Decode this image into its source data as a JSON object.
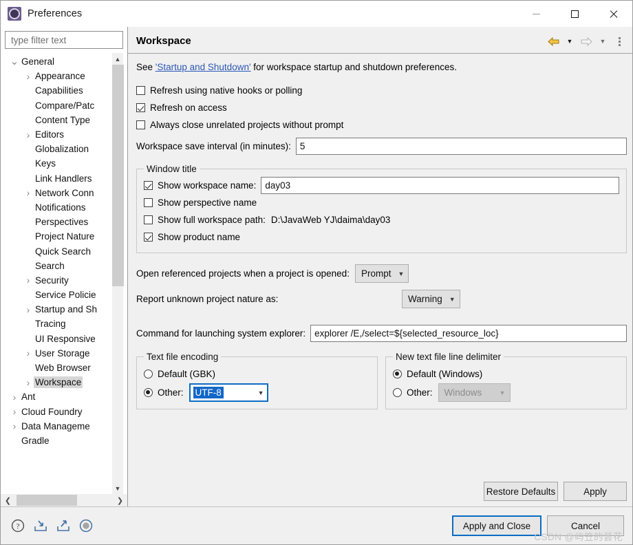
{
  "window": {
    "title": "Preferences",
    "icon": "preferences-gear-icon",
    "controls": {
      "minimize": "—",
      "maximize": "□",
      "close": "✕"
    }
  },
  "sidebar": {
    "filter": {
      "value": "",
      "placeholder": "type filter text"
    },
    "items": [
      {
        "label": "General",
        "level": 0,
        "twisty": "down",
        "selected": false
      },
      {
        "label": "Appearance",
        "level": 1,
        "twisty": "right",
        "selected": false
      },
      {
        "label": "Capabilities",
        "level": 1,
        "twisty": "none",
        "selected": false
      },
      {
        "label": "Compare/Patc",
        "level": 1,
        "twisty": "none",
        "selected": false
      },
      {
        "label": "Content Type",
        "level": 1,
        "twisty": "none",
        "selected": false
      },
      {
        "label": "Editors",
        "level": 1,
        "twisty": "right",
        "selected": false
      },
      {
        "label": "Globalization",
        "level": 1,
        "twisty": "none",
        "selected": false
      },
      {
        "label": "Keys",
        "level": 1,
        "twisty": "none",
        "selected": false
      },
      {
        "label": "Link Handlers",
        "level": 1,
        "twisty": "none",
        "selected": false
      },
      {
        "label": "Network Conn",
        "level": 1,
        "twisty": "right",
        "selected": false
      },
      {
        "label": "Notifications",
        "level": 1,
        "twisty": "none",
        "selected": false
      },
      {
        "label": "Perspectives",
        "level": 1,
        "twisty": "none",
        "selected": false
      },
      {
        "label": "Project Nature",
        "level": 1,
        "twisty": "none",
        "selected": false
      },
      {
        "label": "Quick Search",
        "level": 1,
        "twisty": "none",
        "selected": false
      },
      {
        "label": "Search",
        "level": 1,
        "twisty": "none",
        "selected": false
      },
      {
        "label": "Security",
        "level": 1,
        "twisty": "right",
        "selected": false
      },
      {
        "label": "Service Policie",
        "level": 1,
        "twisty": "none",
        "selected": false
      },
      {
        "label": "Startup and Sh",
        "level": 1,
        "twisty": "right",
        "selected": false
      },
      {
        "label": "Tracing",
        "level": 1,
        "twisty": "none",
        "selected": false
      },
      {
        "label": "UI Responsive",
        "level": 1,
        "twisty": "none",
        "selected": false
      },
      {
        "label": "User Storage",
        "level": 1,
        "twisty": "right",
        "selected": false
      },
      {
        "label": "Web Browser",
        "level": 1,
        "twisty": "none",
        "selected": false
      },
      {
        "label": "Workspace",
        "level": 1,
        "twisty": "right",
        "selected": true
      },
      {
        "label": "Ant",
        "level": 0,
        "twisty": "right",
        "selected": false
      },
      {
        "label": "Cloud Foundry",
        "level": 0,
        "twisty": "right",
        "selected": false
      },
      {
        "label": "Data Manageme",
        "level": 0,
        "twisty": "right",
        "selected": false
      },
      {
        "label": "Gradle",
        "level": 0,
        "twisty": "none",
        "selected": false
      }
    ]
  },
  "page": {
    "title": "Workspace",
    "nav": {
      "back_icon": "back-arrow-icon",
      "back_menu_icon": "chevron-down-icon",
      "forward_icon": "forward-arrow-icon",
      "forward_menu_icon": "chevron-down-icon",
      "menu_icon": "vertical-dots-icon"
    },
    "hint": {
      "before": "See ",
      "link": "'Startup and Shutdown'",
      "after": " for workspace startup and shutdown preferences."
    },
    "checkboxes": [
      {
        "label": "Refresh using native hooks or polling",
        "checked": false
      },
      {
        "label": "Refresh on access",
        "checked": true
      },
      {
        "label": "Always close unrelated projects without prompt",
        "checked": false
      }
    ],
    "save_interval": {
      "label": "Workspace save interval (in minutes):",
      "value": "5"
    },
    "window_title_group": {
      "legend": "Window title",
      "show_workspace_name": {
        "label": "Show workspace name:",
        "checked": true,
        "value": "day03"
      },
      "show_perspective_name": {
        "label": "Show perspective name",
        "checked": false
      },
      "show_full_workspace_path": {
        "label": "Show full workspace path:",
        "checked": false,
        "path": "D:\\JavaWeb  YJ\\daima\\day03"
      },
      "show_product_name": {
        "label": "Show product name",
        "checked": true
      }
    },
    "open_referenced": {
      "label": "Open referenced projects when a project is opened:",
      "value": "Prompt"
    },
    "report_unknown_nature": {
      "label": "Report unknown project nature as:",
      "value": "Warning"
    },
    "system_explorer": {
      "label": "Command for launching system explorer:",
      "value": "explorer /E,/select=${selected_resource_loc}"
    },
    "text_file_encoding": {
      "legend": "Text file encoding",
      "default_label": "Default (GBK)",
      "default_selected": false,
      "other_label": "Other:",
      "other_selected": true,
      "other_value": "UTF-8"
    },
    "line_delimiter": {
      "legend": "New text file line delimiter",
      "default_label": "Default (Windows)",
      "default_selected": true,
      "other_label": "Other:",
      "other_selected": false,
      "other_value": "Windows",
      "other_disabled": true
    },
    "buttons": {
      "restore_defaults": "Restore Defaults",
      "apply": "Apply"
    }
  },
  "footer": {
    "icons": [
      {
        "name": "help-icon"
      },
      {
        "name": "import-icon"
      },
      {
        "name": "export-icon"
      },
      {
        "name": "record-circle-icon"
      }
    ],
    "apply_and_close": "Apply and Close",
    "cancel": "Cancel",
    "watermark": "CSDN @屿笠的昙花"
  },
  "colors": {
    "accent": "#0a6cc4",
    "link": "#2a57b5",
    "selection": "#1267c8",
    "panel": "#f0f0f0",
    "tree_selected": "#d6d6d6"
  }
}
